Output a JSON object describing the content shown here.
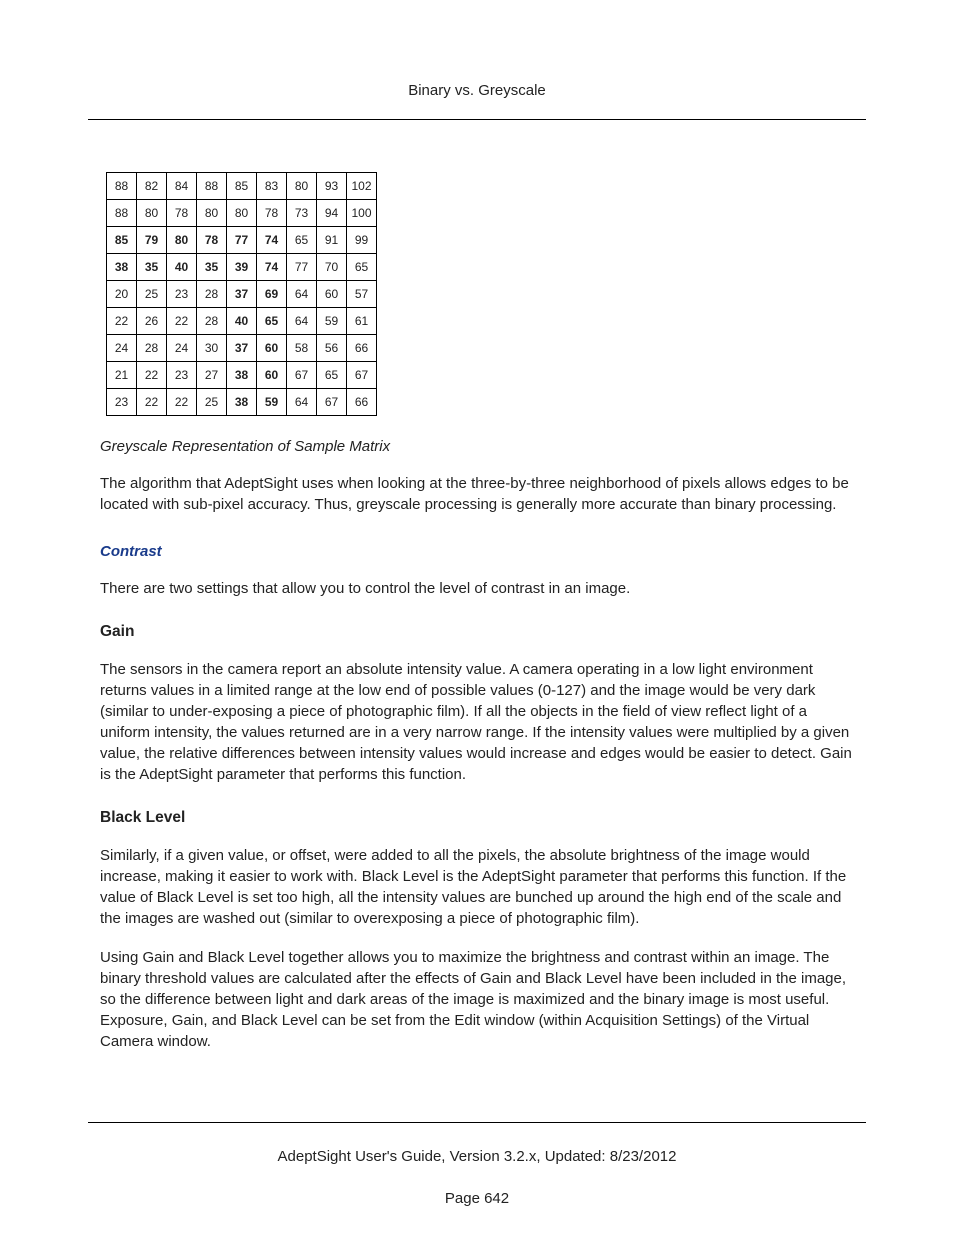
{
  "header": {
    "title": "Binary vs. Greyscale"
  },
  "matrix": {
    "rows": [
      {
        "cells": [
          {
            "v": "88",
            "b": false
          },
          {
            "v": "82",
            "b": false
          },
          {
            "v": "84",
            "b": false
          },
          {
            "v": "88",
            "b": false
          },
          {
            "v": "85",
            "b": false
          },
          {
            "v": "83",
            "b": false
          },
          {
            "v": "80",
            "b": false
          },
          {
            "v": "93",
            "b": false
          },
          {
            "v": "102",
            "b": false
          }
        ]
      },
      {
        "cells": [
          {
            "v": "88",
            "b": false
          },
          {
            "v": "80",
            "b": false
          },
          {
            "v": "78",
            "b": false
          },
          {
            "v": "80",
            "b": false
          },
          {
            "v": "80",
            "b": false
          },
          {
            "v": "78",
            "b": false
          },
          {
            "v": "73",
            "b": false
          },
          {
            "v": "94",
            "b": false
          },
          {
            "v": "100",
            "b": false
          }
        ]
      },
      {
        "cells": [
          {
            "v": "85",
            "b": true
          },
          {
            "v": "79",
            "b": true
          },
          {
            "v": "80",
            "b": true
          },
          {
            "v": "78",
            "b": true
          },
          {
            "v": "77",
            "b": true
          },
          {
            "v": "74",
            "b": true
          },
          {
            "v": "65",
            "b": false
          },
          {
            "v": "91",
            "b": false
          },
          {
            "v": "99",
            "b": false
          }
        ]
      },
      {
        "cells": [
          {
            "v": "38",
            "b": true
          },
          {
            "v": "35",
            "b": true
          },
          {
            "v": "40",
            "b": true
          },
          {
            "v": "35",
            "b": true
          },
          {
            "v": "39",
            "b": true
          },
          {
            "v": "74",
            "b": true
          },
          {
            "v": "77",
            "b": false
          },
          {
            "v": "70",
            "b": false
          },
          {
            "v": "65",
            "b": false
          }
        ]
      },
      {
        "cells": [
          {
            "v": "20",
            "b": false
          },
          {
            "v": "25",
            "b": false
          },
          {
            "v": "23",
            "b": false
          },
          {
            "v": "28",
            "b": false
          },
          {
            "v": "37",
            "b": true
          },
          {
            "v": "69",
            "b": true
          },
          {
            "v": "64",
            "b": false
          },
          {
            "v": "60",
            "b": false
          },
          {
            "v": "57",
            "b": false
          }
        ]
      },
      {
        "cells": [
          {
            "v": "22",
            "b": false
          },
          {
            "v": "26",
            "b": false
          },
          {
            "v": "22",
            "b": false
          },
          {
            "v": "28",
            "b": false
          },
          {
            "v": "40",
            "b": true
          },
          {
            "v": "65",
            "b": true
          },
          {
            "v": "64",
            "b": false
          },
          {
            "v": "59",
            "b": false
          },
          {
            "v": "61",
            "b": false
          }
        ]
      },
      {
        "cells": [
          {
            "v": "24",
            "b": false
          },
          {
            "v": "28",
            "b": false
          },
          {
            "v": "24",
            "b": false
          },
          {
            "v": "30",
            "b": false
          },
          {
            "v": "37",
            "b": true
          },
          {
            "v": "60",
            "b": true
          },
          {
            "v": "58",
            "b": false
          },
          {
            "v": "56",
            "b": false
          },
          {
            "v": "66",
            "b": false
          }
        ]
      },
      {
        "cells": [
          {
            "v": "21",
            "b": false
          },
          {
            "v": "22",
            "b": false
          },
          {
            "v": "23",
            "b": false
          },
          {
            "v": "27",
            "b": false
          },
          {
            "v": "38",
            "b": true
          },
          {
            "v": "60",
            "b": true
          },
          {
            "v": "67",
            "b": false
          },
          {
            "v": "65",
            "b": false
          },
          {
            "v": "67",
            "b": false
          }
        ]
      },
      {
        "cells": [
          {
            "v": "23",
            "b": false
          },
          {
            "v": "22",
            "b": false
          },
          {
            "v": "22",
            "b": false
          },
          {
            "v": "25",
            "b": false
          },
          {
            "v": "38",
            "b": true
          },
          {
            "v": "59",
            "b": true
          },
          {
            "v": "64",
            "b": false
          },
          {
            "v": "67",
            "b": false
          },
          {
            "v": "66",
            "b": false
          }
        ]
      }
    ]
  },
  "caption": "Greyscale Representation of Sample Matrix",
  "para_intro": "The algorithm that AdeptSight uses when looking at the three-by-three neighborhood of pixels allows edges to be located with sub-pixel accuracy. Thus, greyscale processing is generally more accurate than binary processing.",
  "contrast": {
    "heading": "Contrast",
    "text": "There are two settings that allow you to control the level of contrast in an image."
  },
  "gain": {
    "heading": "Gain",
    "text": "The sensors in the camera report an absolute intensity value. A camera operating in a low light environment returns values in a limited range at the low end of possible values (0-127) and the image would be very dark (similar to under-exposing a piece of photographic film). If all the objects in the field of view reflect light of a uniform intensity, the values returned are in a very narrow range. If the intensity values were multiplied by a given value, the relative differences between intensity values would increase and edges would be easier to detect. Gain is the AdeptSight parameter that performs this function."
  },
  "black": {
    "heading": "Black Level",
    "p1": "Similarly, if a given value, or offset, were added to all the pixels, the absolute brightness of the image would increase, making it easier to work with. Black Level is the AdeptSight parameter that performs this function. If the value of Black Level is set too high, all the intensity values are bunched up around the high end of the scale and the images are washed out (similar to overexposing a piece of photographic film).",
    "p2": "Using Gain and Black Level together allows you to maximize the brightness and contrast within an image. The binary threshold values are calculated after the effects of Gain and Black Level have been included in the image, so the difference between light and dark areas of the image is maximized and the binary image is most useful. Exposure, Gain, and Black Level can be set from the Edit window (within Acquisition Settings) of the Virtual Camera window."
  },
  "footer": {
    "line1": "AdeptSight User's Guide,  Version 3.2.x, Updated: 8/23/2012",
    "line2": "Page 642"
  }
}
